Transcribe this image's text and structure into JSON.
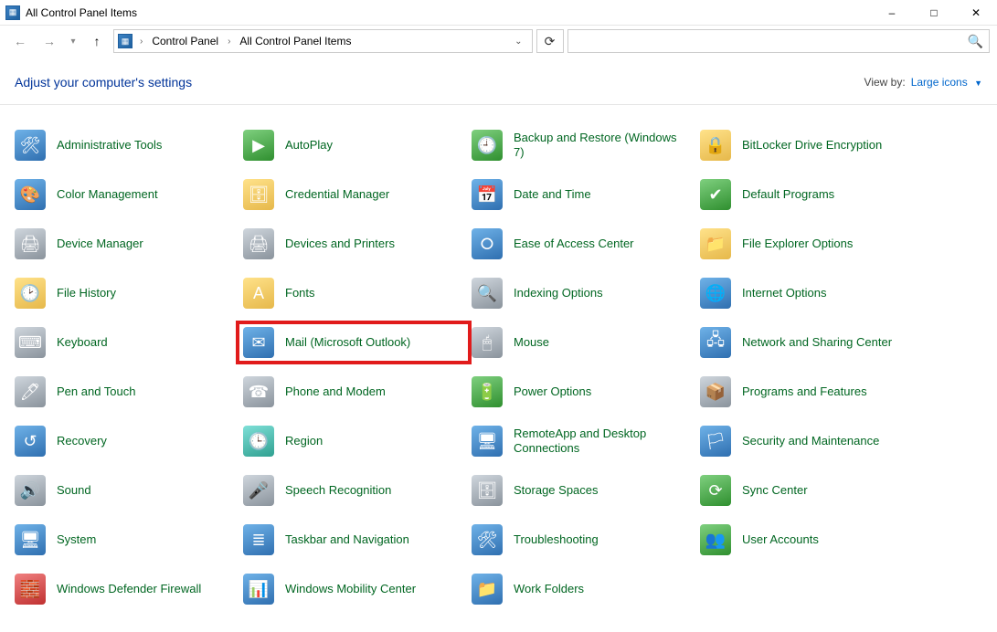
{
  "window": {
    "title": "All Control Panel Items"
  },
  "breadcrumbs": {
    "root": "Control Panel",
    "current": "All Control Panel Items"
  },
  "header": {
    "heading": "Adjust your computer's settings",
    "viewby_label": "View by:",
    "viewby_value": "Large icons"
  },
  "highlighted_item_index": 17,
  "items": [
    {
      "label": "Administrative Tools",
      "icon_glyph": "🛠",
      "color": "ic-blue"
    },
    {
      "label": "AutoPlay",
      "icon_glyph": "▶",
      "color": "ic-green"
    },
    {
      "label": "Backup and Restore (Windows 7)",
      "icon_glyph": "🕘",
      "color": "ic-green"
    },
    {
      "label": "BitLocker Drive Encryption",
      "icon_glyph": "🔒",
      "color": "ic-yellow"
    },
    {
      "label": "Color Management",
      "icon_glyph": "🎨",
      "color": "ic-blue"
    },
    {
      "label": "Credential Manager",
      "icon_glyph": "🗄",
      "color": "ic-yellow"
    },
    {
      "label": "Date and Time",
      "icon_glyph": "📅",
      "color": "ic-blue"
    },
    {
      "label": "Default Programs",
      "icon_glyph": "✔",
      "color": "ic-green"
    },
    {
      "label": "Device Manager",
      "icon_glyph": "🖨",
      "color": "ic-gray"
    },
    {
      "label": "Devices and Printers",
      "icon_glyph": "🖨",
      "color": "ic-gray"
    },
    {
      "label": "Ease of Access Center",
      "icon_glyph": "⭘",
      "color": "ic-blue"
    },
    {
      "label": "File Explorer Options",
      "icon_glyph": "📁",
      "color": "ic-yellow"
    },
    {
      "label": "File History",
      "icon_glyph": "🕑",
      "color": "ic-yellow"
    },
    {
      "label": "Fonts",
      "icon_glyph": "A",
      "color": "ic-yellow"
    },
    {
      "label": "Indexing Options",
      "icon_glyph": "🔍",
      "color": "ic-gray"
    },
    {
      "label": "Internet Options",
      "icon_glyph": "🌐",
      "color": "ic-blue"
    },
    {
      "label": "Keyboard",
      "icon_glyph": "⌨",
      "color": "ic-gray"
    },
    {
      "label": "Mail (Microsoft Outlook)",
      "icon_glyph": "✉",
      "color": "ic-blue"
    },
    {
      "label": "Mouse",
      "icon_glyph": "🖱",
      "color": "ic-gray"
    },
    {
      "label": "Network and Sharing Center",
      "icon_glyph": "🖧",
      "color": "ic-blue"
    },
    {
      "label": "Pen and Touch",
      "icon_glyph": "🖊",
      "color": "ic-gray"
    },
    {
      "label": "Phone and Modem",
      "icon_glyph": "☎",
      "color": "ic-gray"
    },
    {
      "label": "Power Options",
      "icon_glyph": "🔋",
      "color": "ic-green"
    },
    {
      "label": "Programs and Features",
      "icon_glyph": "📦",
      "color": "ic-gray"
    },
    {
      "label": "Recovery",
      "icon_glyph": "↺",
      "color": "ic-blue"
    },
    {
      "label": "Region",
      "icon_glyph": "🕒",
      "color": "ic-teal"
    },
    {
      "label": "RemoteApp and Desktop Connections",
      "icon_glyph": "🖥",
      "color": "ic-blue"
    },
    {
      "label": "Security and Maintenance",
      "icon_glyph": "🏳",
      "color": "ic-blue"
    },
    {
      "label": "Sound",
      "icon_glyph": "🔊",
      "color": "ic-gray"
    },
    {
      "label": "Speech Recognition",
      "icon_glyph": "🎤",
      "color": "ic-gray"
    },
    {
      "label": "Storage Spaces",
      "icon_glyph": "🗄",
      "color": "ic-gray"
    },
    {
      "label": "Sync Center",
      "icon_glyph": "⟳",
      "color": "ic-green"
    },
    {
      "label": "System",
      "icon_glyph": "🖥",
      "color": "ic-blue"
    },
    {
      "label": "Taskbar and Navigation",
      "icon_glyph": "≣",
      "color": "ic-blue"
    },
    {
      "label": "Troubleshooting",
      "icon_glyph": "🛠",
      "color": "ic-blue"
    },
    {
      "label": "User Accounts",
      "icon_glyph": "👥",
      "color": "ic-green"
    },
    {
      "label": "Windows Defender Firewall",
      "icon_glyph": "🧱",
      "color": "ic-red"
    },
    {
      "label": "Windows Mobility Center",
      "icon_glyph": "📊",
      "color": "ic-blue"
    },
    {
      "label": "Work Folders",
      "icon_glyph": "📁",
      "color": "ic-blue"
    }
  ]
}
